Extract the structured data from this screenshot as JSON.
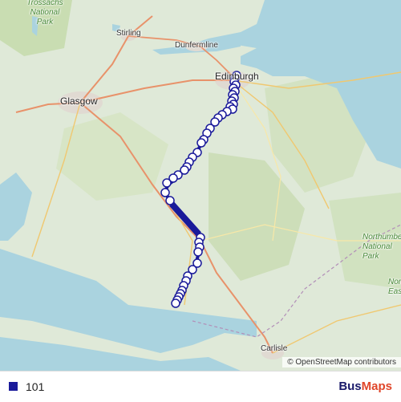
{
  "map": {
    "places": {
      "trossachs": "Trossachs National Park",
      "stirling": "Stirling",
      "dunfermline": "Dunfermline",
      "edinburgh": "Edinburgh",
      "glasgow": "Glasgow",
      "carlisle": "Carlisle",
      "northumberland": "Northumberland National Park",
      "north_east": "North East"
    },
    "attribution": "© OpenStreetMap contributors",
    "route_color": "#1a1a9a"
  },
  "legend": {
    "route_label": "101",
    "brand_part1": "Bus",
    "brand_part2": "Maps"
  }
}
